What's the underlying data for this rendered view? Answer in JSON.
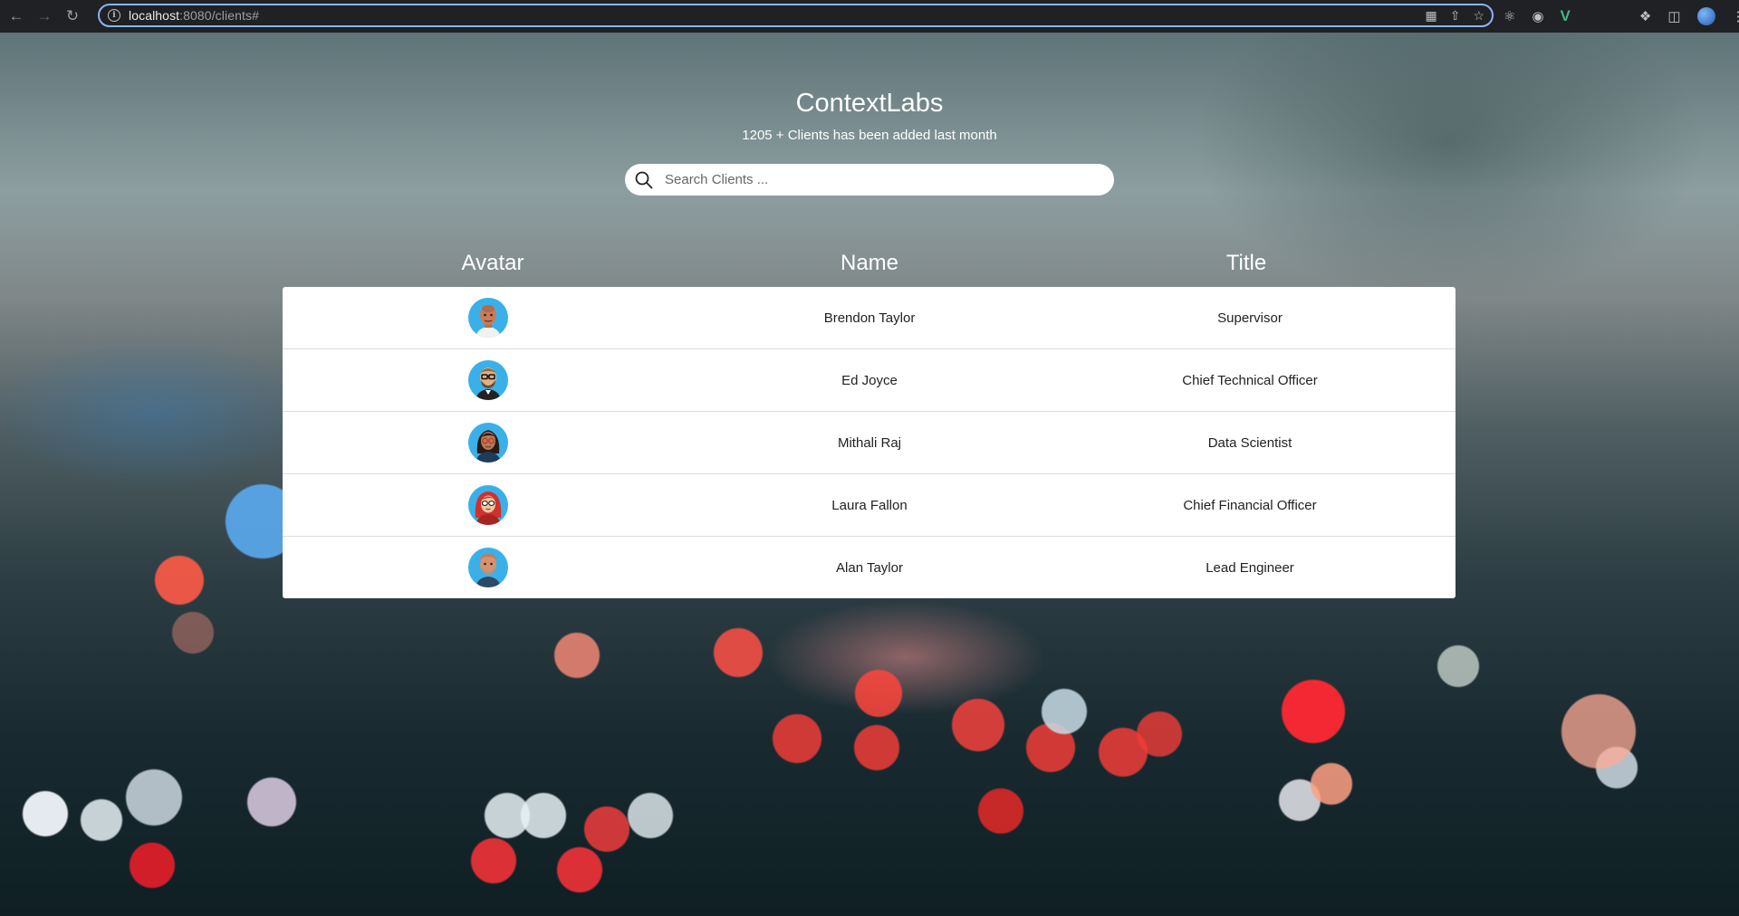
{
  "browser": {
    "url_host": "localhost",
    "url_rest": ":8080/clients#"
  },
  "header": {
    "title": "ContextLabs",
    "subtitle": "1205 + Clients has been added last month"
  },
  "search": {
    "placeholder": "Search Clients ..."
  },
  "table": {
    "columns": [
      "Avatar",
      "Name",
      "Title"
    ],
    "rows": [
      {
        "name": "Brendon Taylor",
        "title": "Supervisor",
        "avatar": "bald-man-avatar"
      },
      {
        "name": "Ed Joyce",
        "title": "Chief Technical Officer",
        "avatar": "glasses-bearded-man-avatar"
      },
      {
        "name": "Mithali Raj",
        "title": "Data Scientist",
        "avatar": "woman-glasses-avatar"
      },
      {
        "name": "Laura Fallon",
        "title": "Chief Financial Officer",
        "avatar": "red-hair-woman-avatar"
      },
      {
        "name": "Alan Taylor",
        "title": "Lead Engineer",
        "avatar": "bald-bearded-man-avatar"
      }
    ]
  },
  "colors": {
    "avatar_bg": "#3bb0e8",
    "omnibox_focus": "#8ab4f8",
    "chrome_bg": "#202124"
  }
}
